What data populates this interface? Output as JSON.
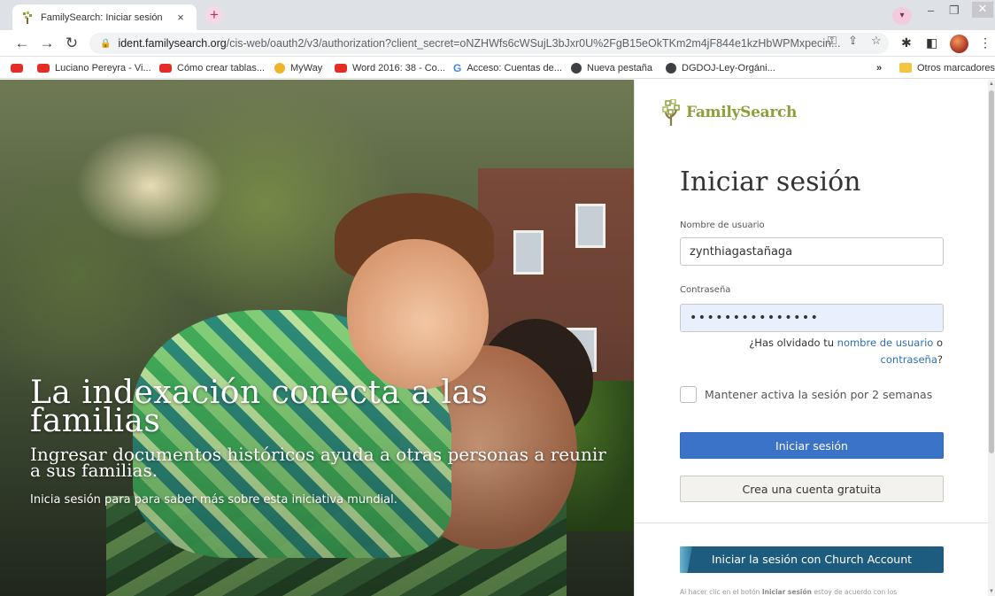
{
  "browser": {
    "tab_title": "FamilySearch: Iniciar sesión",
    "tab_close": "×",
    "new_tab": "+",
    "url_host": "ident.familysearch.org",
    "url_path": "/cis-web/oauth2/v3/authorization?client_secret=oNZHWfs6cWSujL3bJxr0U%2FgB15eOkTKm2m4jF844e1kzHbWPMxpecin...",
    "bookmarks": [
      {
        "label": "Luciano Pereyra - Vi...",
        "icon": "youtube-icon"
      },
      {
        "label": "Cómo crear tablas...",
        "icon": "youtube-icon"
      },
      {
        "label": "MyWay",
        "icon": "myway-icon"
      },
      {
        "label": "Word 2016: 38 - Co...",
        "icon": "youtube-icon"
      },
      {
        "label": "Acceso: Cuentas de...",
        "icon": "google-icon"
      },
      {
        "label": "Nueva pestaña",
        "icon": "globe-icon"
      },
      {
        "label": "DGDOJ-Ley-Orgáni...",
        "icon": "globe-icon"
      }
    ],
    "bookmarks_more": "»",
    "other_bookmarks": "Otros marcadores"
  },
  "hero": {
    "title": "La indexación conecta a las familias",
    "subtitle": "Ingresar documentos históricos ayuda a otras personas a reunir a sus familias.",
    "cta": "Inicia sesión para para saber más sobre esta iniciativa mundial."
  },
  "login": {
    "brand": "FamilySearch",
    "title": "Iniciar sesión",
    "username_label": "Nombre de usuario",
    "username_value": "zynthiagastañaga",
    "password_label": "Contraseña",
    "password_value": "•••••••••••••••",
    "forgot_prefix": "¿Has olvidado tu ",
    "forgot_username": "nombre de usuario",
    "forgot_or": " o",
    "forgot_password": "contraseña",
    "forgot_suffix": "?",
    "keep_signed_in": "Mantener activa la sesión por 2 semanas",
    "signin_button": "Iniciar sesión",
    "create_account_button": "Crea una cuenta gratuita",
    "church_account_button": "Iniciar la sesión con Church Account",
    "terms_prefix": "Al hacer clic en el botón ",
    "terms_bold": "Iniciar sesión",
    "terms_suffix": " estoy de acuerdo con los"
  },
  "colors": {
    "primary_button": "#3a73c8",
    "church_button": "#1d5c7e",
    "brand_green": "#8ba03a",
    "link": "#2f6fb4"
  }
}
